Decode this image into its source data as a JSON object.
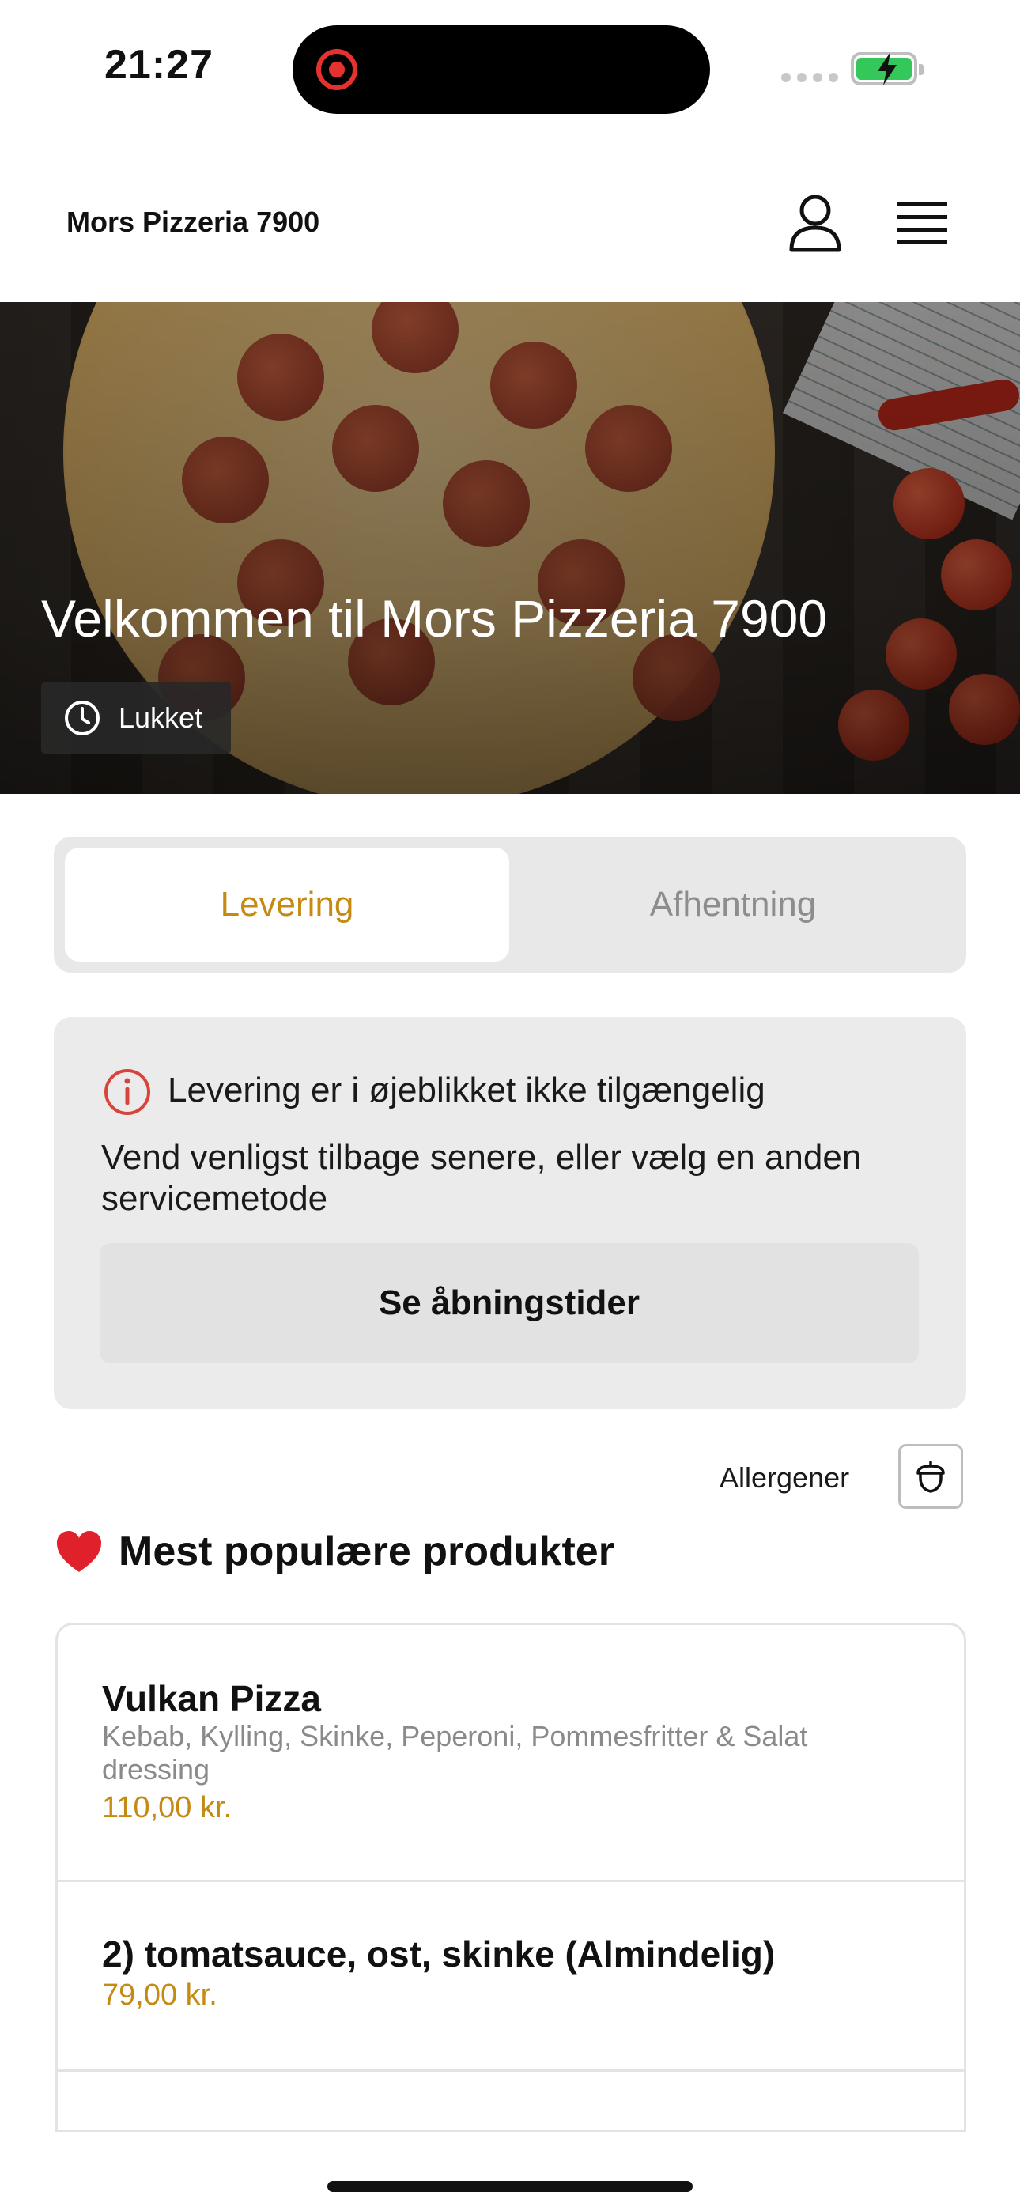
{
  "status_bar": {
    "time": "21:27",
    "recording_indicator_color": "#e5322f",
    "battery_color": "#34c759",
    "battery_state": "charging"
  },
  "header": {
    "brand": "Mors Pizzeria 7900",
    "profile_icon": "person-icon",
    "menu_icon": "hamburger-menu-icon"
  },
  "hero": {
    "title": "Velkommen til Mors Pizzeria 7900",
    "status_icon": "clock-icon",
    "status": "Lukket"
  },
  "tabs": {
    "items": [
      {
        "label": "Levering",
        "active": true
      },
      {
        "label": "Afhentning",
        "active": false
      }
    ],
    "accent_color": "#c58a12"
  },
  "notice": {
    "icon": "info-icon",
    "icon_color": "#d9443a",
    "title": "Levering er i øjeblikket ikke tilgængelig",
    "body": "Vend venligst tilbage senere, eller vælg en anden servicemetode",
    "button_label": "Se åbningstider"
  },
  "allergens": {
    "label": "Allergener",
    "icon": "acorn-icon"
  },
  "popular": {
    "emoji": "❤️",
    "title": "Mest populære produkter",
    "products": [
      {
        "name": "Vulkan Pizza",
        "description": "Kebab, Kylling, Skinke, Peperoni, Pommesfritter & Salat dressing",
        "price": "110,00 kr."
      },
      {
        "name": "2) tomatsauce, ost, skinke (Almindelig)",
        "description": "",
        "price": "79,00 kr."
      }
    ]
  }
}
